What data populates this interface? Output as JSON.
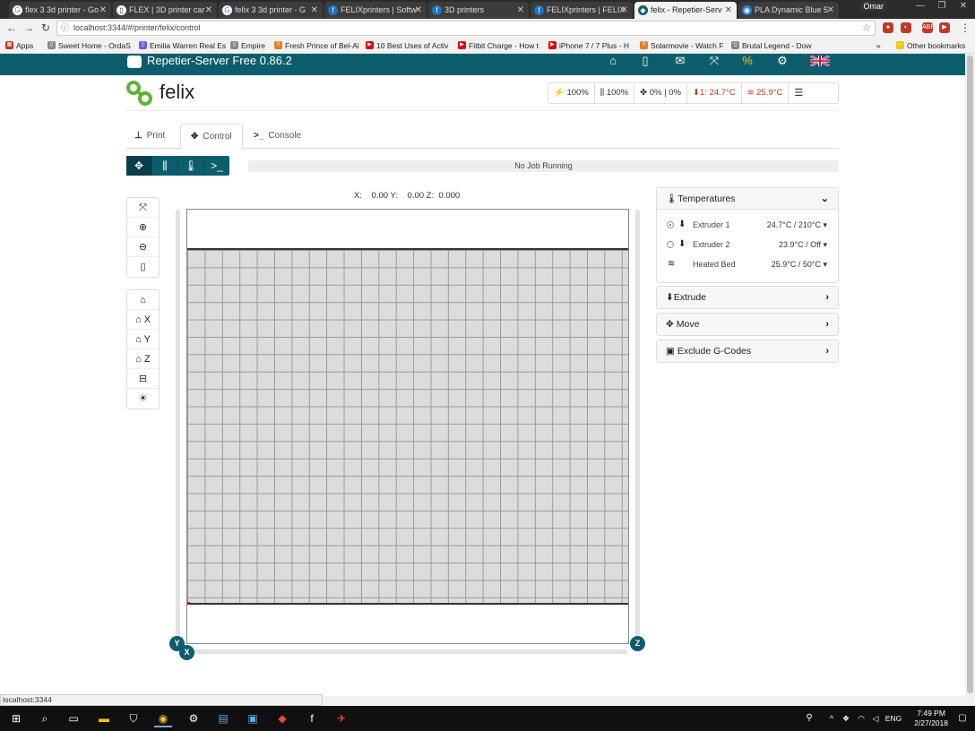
{
  "browser": {
    "tabs": [
      {
        "title": "flex 3 3d printer - Go",
        "icon": "google-icon",
        "color": "#ffffff"
      },
      {
        "title": "FLEX | 3D printer car",
        "icon": "page-icon",
        "color": "#ffffff"
      },
      {
        "title": "felix 3 3d printer - G",
        "icon": "google-icon",
        "color": "#ffffff"
      },
      {
        "title": "FELIXprinters | Softw",
        "icon": "felix-icon",
        "color": "#1e73be"
      },
      {
        "title": "3D printers",
        "icon": "felix-icon",
        "color": "#1e73be"
      },
      {
        "title": "FELIXprinters | FELIX",
        "icon": "felix-icon",
        "color": "#1e73be"
      },
      {
        "title": "felix - Repetier-Serv",
        "icon": "repetier-icon",
        "color": "#0d5e6d"
      },
      {
        "title": "PLA Dynamic Blue 5",
        "icon": "pla-icon",
        "color": "#2a7fd4"
      }
    ],
    "profile_name": "Omar",
    "url": "localhost:3344/#/printer/felix/control",
    "bookmarks": [
      {
        "label": "Apps",
        "icon": "apps-icon",
        "color": "#c0392b"
      },
      {
        "label": "Sweet Home - OrdaS",
        "icon": "page-icon",
        "color": "#888888"
      },
      {
        "label": "Emilia Warren Real Es",
        "icon": "bookmark-icon",
        "color": "#6c5ce7"
      },
      {
        "label": "Empire",
        "icon": "page-icon",
        "color": "#888888"
      },
      {
        "label": "Fresh Prince of Bel-Ai",
        "icon": "bookmark-icon",
        "color": "#e67e22"
      },
      {
        "label": "10 Best Uses of Activ",
        "icon": "youtube-icon",
        "color": "#e00000"
      },
      {
        "label": "Fitbit Charge - How t",
        "icon": "youtube-icon",
        "color": "#e00000"
      },
      {
        "label": "iPhone 7 / 7 Plus - H",
        "icon": "youtube-icon",
        "color": "#e00000"
      },
      {
        "label": "Solarmovie - Watch F",
        "icon": "bookmark-icon",
        "color": "#e67e22"
      },
      {
        "label": "Brutal Legend - Dow",
        "icon": "page-icon",
        "color": "#888888"
      }
    ],
    "more_bookmarks": "»",
    "other_bookmarks": "Other bookmarks",
    "status_url": "localhost:3344"
  },
  "app": {
    "header_title": "Repetier-Server Free 0.86.2",
    "printer_name": "felix",
    "status": {
      "speed": "100%",
      "flow": "100%",
      "fan": "0% | 0%",
      "extruder_temp": "1: 24.7°C",
      "bed_temp": "25.9°C"
    },
    "tabs": [
      {
        "label": "Print",
        "icon": "print-icon"
      },
      {
        "label": "Control",
        "icon": "move-icon"
      },
      {
        "label": "Console",
        "icon": "console-icon"
      }
    ],
    "job_status": "No Job Running",
    "coordinates": {
      "x_label": "X:",
      "x": "0.00",
      "y_label": "Y:",
      "y": "0.00",
      "z_label": "Z:",
      "z": "0.000"
    },
    "axis_labels": {
      "y": "Y",
      "x": "X",
      "z": "Z"
    },
    "home_buttons": {
      "x": "X",
      "y": "Y",
      "z": "Z"
    },
    "panels": {
      "temperatures": {
        "title": "Temperatures",
        "rows": [
          {
            "name": "Extruder 1",
            "value": "24.7°C / 210°C"
          },
          {
            "name": "Extruder 2",
            "value": "23.9°C / Off"
          },
          {
            "name": "Heated Bed",
            "value": "25.9°C / 50°C"
          }
        ]
      },
      "extrude": {
        "title": "Extrude"
      },
      "move": {
        "title": "Move"
      },
      "exclude": {
        "title": "Exclude G-Codes"
      }
    },
    "colors": {
      "primary": "#0d5e6d",
      "danger": "#c0392b",
      "logo_green": "#5fb336"
    }
  },
  "taskbar": {
    "time": "7:49 PM",
    "date": "2/27/2018",
    "language": "ENG"
  }
}
